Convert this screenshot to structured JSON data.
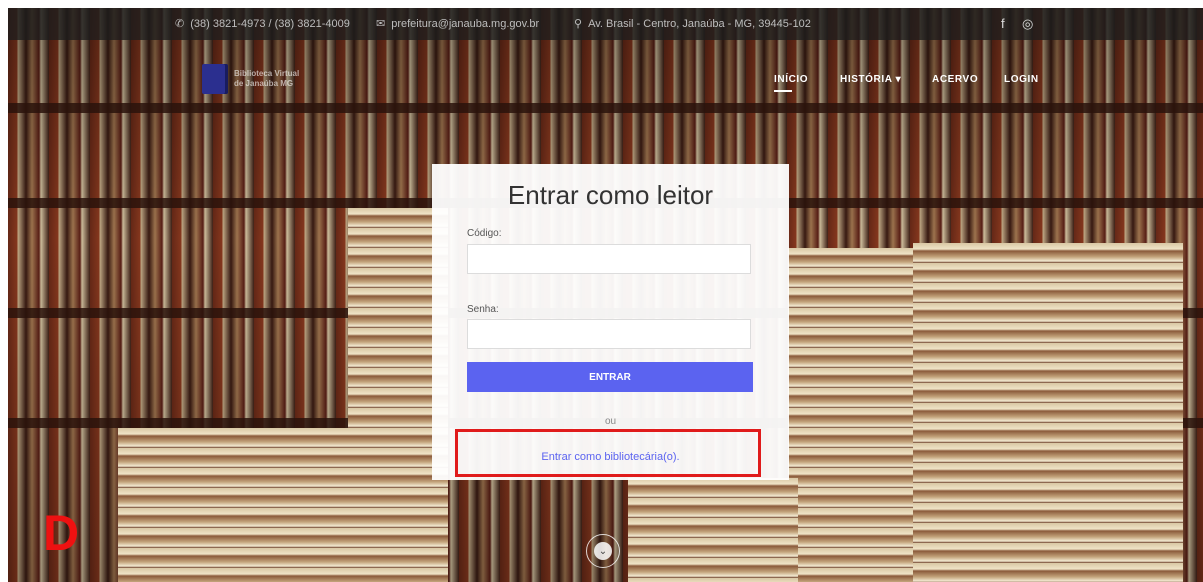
{
  "topbar": {
    "phone": "(38) 3821-4973 / (38) 3821-4009",
    "email": "prefeitura@janauba.mg.gov.br",
    "address": "Av. Brasil - Centro, Janaúba - MG, 39445-102",
    "social": [
      {
        "icon": "facebook-icon",
        "glyph": "f"
      },
      {
        "icon": "instagram-icon",
        "glyph": "◎"
      }
    ]
  },
  "logo": {
    "line1": "Biblioteca Virtual",
    "line2": "de Janaúba MG"
  },
  "nav": {
    "inicio": "INÍCIO",
    "historia": "HISTÓRIA",
    "historia_caret": "▾",
    "acervo": "ACERVO",
    "login": "LOGIN"
  },
  "login_card": {
    "title": "Entrar como leitor",
    "code_label": "Código:",
    "code_value": "",
    "password_label": "Senha:",
    "password_value": "",
    "submit_label": "ENTRAR",
    "or_text": "ou",
    "librarian_link": "Entrar como bibliotecária(o)."
  },
  "overlay": {
    "letter": "D",
    "highlight_color": "#e01b1b"
  },
  "colors": {
    "accent": "#5b63f0",
    "topbar_bg": "#1e1e1e"
  }
}
